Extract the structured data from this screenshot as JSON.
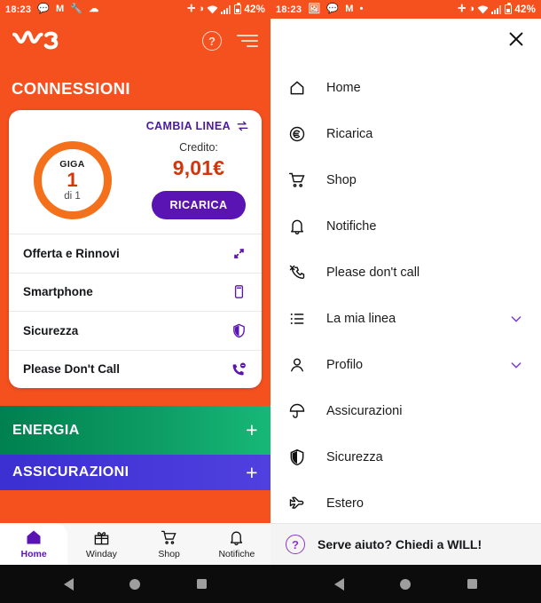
{
  "status_bar": {
    "time": "18:23",
    "battery_percent": "42%",
    "left_icons": [
      "chat-icon",
      "gmail-icon",
      "wrench-icon",
      "cloud-icon"
    ],
    "left_icons_right_pane": [
      "image-icon",
      "chat-icon",
      "gmail-icon",
      "dot-icon"
    ],
    "right_icons": [
      "bluetooth-icon",
      "dnd-icon",
      "wifi-icon",
      "signal-icon",
      "battery-icon"
    ]
  },
  "app": {
    "logo_alt": "WindTre",
    "help_icon": "?",
    "section_title": "CONNESSIONI"
  },
  "line_card": {
    "switch_line_label": "CAMBIA LINEA",
    "gauge": {
      "label": "GIGA",
      "value": "1",
      "sub": "di 1"
    },
    "credit": {
      "label": "Credito:",
      "value": "9,01€",
      "button": "RICARICA"
    },
    "rows": [
      {
        "label": "Offerta e Rinnovi",
        "icon": "arrows-expand-icon"
      },
      {
        "label": "Smartphone",
        "icon": "smartphone-icon"
      },
      {
        "label": "Sicurezza",
        "icon": "shield-icon"
      },
      {
        "label": "Please Don't Call",
        "icon": "phone-block-icon"
      }
    ]
  },
  "banners": [
    {
      "title": "ENERGIA",
      "action": "+"
    },
    {
      "title": "ASSICURAZIONI",
      "action": "+"
    }
  ],
  "bottom_tabs": [
    {
      "label": "Home",
      "icon": "home-icon",
      "active": true
    },
    {
      "label": "Winday",
      "icon": "gift-icon",
      "active": false
    },
    {
      "label": "Shop",
      "icon": "cart-icon",
      "active": false
    },
    {
      "label": "Notifiche",
      "icon": "bell-icon",
      "active": false
    }
  ],
  "drawer": {
    "close_icon": "close-icon",
    "items": [
      {
        "label": "Home",
        "icon": "home-icon",
        "chevron": false
      },
      {
        "label": "Ricarica",
        "icon": "euro-circle-icon",
        "chevron": false
      },
      {
        "label": "Shop",
        "icon": "cart-icon",
        "chevron": false
      },
      {
        "label": "Notifiche",
        "icon": "bell-icon",
        "chevron": false
      },
      {
        "label": "Please don't call",
        "icon": "phone-block-icon",
        "chevron": false
      },
      {
        "label": "La mia linea",
        "icon": "list-icon",
        "chevron": true
      },
      {
        "label": "Profilo",
        "icon": "person-icon",
        "chevron": true
      },
      {
        "label": "Assicurazioni",
        "icon": "umbrella-icon",
        "chevron": false
      },
      {
        "label": "Sicurezza",
        "icon": "shield-icon",
        "chevron": false
      },
      {
        "label": "Estero",
        "icon": "airplane-icon",
        "chevron": false
      }
    ],
    "help_bar": {
      "icon": "question-circle-icon",
      "text": "Serve aiuto? Chiedi a WILL!"
    }
  },
  "android_nav": {
    "back": "back-icon",
    "home": "home-icon",
    "recents": "recents-icon"
  },
  "colors": {
    "orange": "#f4511e",
    "orange_accent": "#f4701b",
    "purple": "#5b14b4",
    "red_text": "#d1370a",
    "green_start": "#00804f",
    "green_end": "#17b877",
    "blue": "#3b2fd1"
  }
}
